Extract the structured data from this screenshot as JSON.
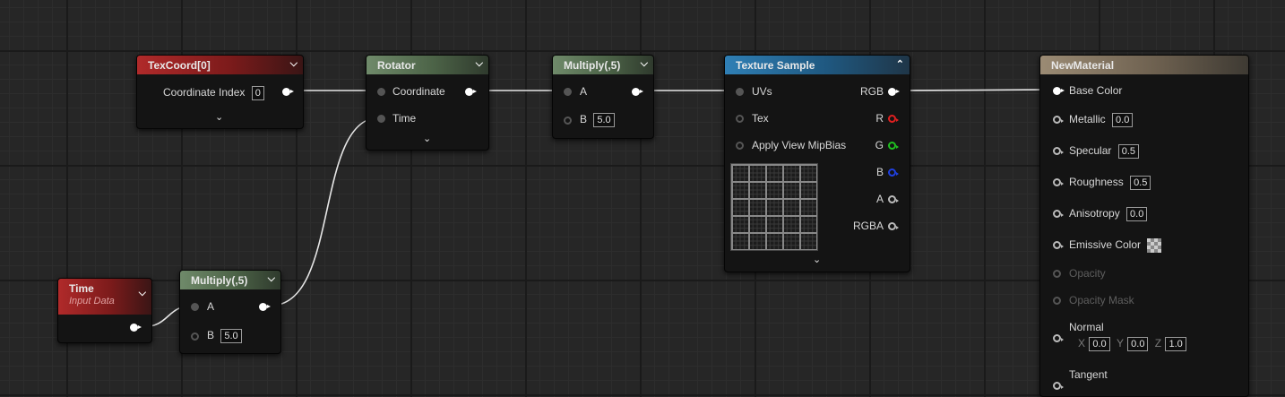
{
  "nodes": {
    "texcoord": {
      "title": "TexCoord[0]",
      "coordinate_index_label": "Coordinate Index",
      "coordinate_index_value": "0"
    },
    "rotator": {
      "title": "Rotator",
      "coordinate_label": "Coordinate",
      "time_label": "Time"
    },
    "multiply_top": {
      "title": "Multiply(,5)",
      "a_label": "A",
      "b_label": "B",
      "b_value": "5.0"
    },
    "texture_sample": {
      "title": "Texture Sample",
      "inputs": [
        "UVs",
        "Tex",
        "Apply View MipBias"
      ],
      "outputs": [
        "RGB",
        "R",
        "G",
        "B",
        "A",
        "RGBA"
      ]
    },
    "time": {
      "title": "Time",
      "subtitle": "Input Data"
    },
    "multiply_bottom": {
      "title": "Multiply(,5)",
      "a_label": "A",
      "b_label": "B",
      "b_value": "5.0"
    },
    "new_material": {
      "title": "NewMaterial",
      "base_color": "Base Color",
      "metallic": "Metallic",
      "metallic_value": "0.0",
      "specular": "Specular",
      "specular_value": "0.5",
      "roughness": "Roughness",
      "roughness_value": "0.5",
      "anisotropy": "Anisotropy",
      "anisotropy_value": "0.0",
      "emissive_color": "Emissive Color",
      "opacity": "Opacity",
      "opacity_mask": "Opacity Mask",
      "normal": "Normal",
      "normal_x_label": "X",
      "normal_x": "0.0",
      "normal_y_label": "Y",
      "normal_y": "0.0",
      "normal_z_label": "Z",
      "normal_z": "1.0",
      "tangent": "Tangent"
    }
  },
  "colors": {
    "constant_header": "#9c1f1f",
    "math_header": "#5a7456",
    "texture_header": "#246a9c",
    "material_header": "#8a7b66",
    "wire": "#e8e8e8"
  }
}
